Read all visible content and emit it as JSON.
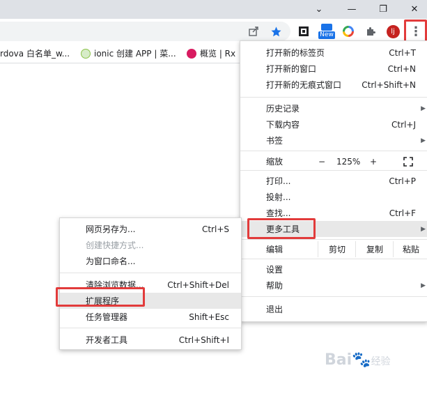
{
  "window_controls": {
    "minimize": "—",
    "restore": "❐",
    "close": "✕",
    "tab_search": "⌄"
  },
  "toolbar": {
    "share_icon": "share-icon",
    "star_icon": "star-icon",
    "new_badge": "New",
    "profile_initial": "lj",
    "menu_dots": "⋮"
  },
  "bookmarks": [
    {
      "label": "rdova 白名单_w..."
    },
    {
      "label": "ionic 创建 APP | 菜..."
    },
    {
      "label": "概览 | Rx"
    }
  ],
  "main_menu": {
    "items": {
      "new_tab": {
        "label": "打开新的标签页",
        "shortcut": "Ctrl+T"
      },
      "new_window": {
        "label": "打开新的窗口",
        "shortcut": "Ctrl+N"
      },
      "incognito": {
        "label": "打开新的无痕式窗口",
        "shortcut": "Ctrl+Shift+N"
      },
      "history": {
        "label": "历史记录"
      },
      "downloads": {
        "label": "下载内容",
        "shortcut": "Ctrl+J"
      },
      "bookmarks": {
        "label": "书签"
      },
      "zoom": {
        "label": "缩放",
        "minus": "−",
        "value": "125%",
        "plus": "+"
      },
      "print": {
        "label": "打印...",
        "shortcut": "Ctrl+P"
      },
      "cast": {
        "label": "投射..."
      },
      "find": {
        "label": "查找...",
        "shortcut": "Ctrl+F"
      },
      "more_tools": {
        "label": "更多工具"
      },
      "edit": {
        "label": "编辑",
        "cut": "剪切",
        "copy": "复制",
        "paste": "粘贴"
      },
      "settings": {
        "label": "设置"
      },
      "help": {
        "label": "帮助"
      },
      "exit": {
        "label": "退出"
      }
    }
  },
  "sub_menu": {
    "save_page": {
      "label": "网页另存为...",
      "shortcut": "Ctrl+S"
    },
    "create_shortcut": {
      "label": "创建快捷方式..."
    },
    "name_window": {
      "label": "为窗口命名..."
    },
    "clear_data": {
      "label": "清除浏览数据...",
      "shortcut": "Ctrl+Shift+Del"
    },
    "extensions": {
      "label": "扩展程序"
    },
    "task_manager": {
      "label": "任务管理器",
      "shortcut": "Shift+Esc"
    },
    "dev_tools": {
      "label": "开发者工具",
      "shortcut": "Ctrl+Shift+I"
    }
  },
  "watermark": {
    "text": "Bai",
    "suffix": "经验"
  },
  "colors": {
    "highlight": "#e23b3b",
    "star": "#1a73e8",
    "avatar": "#c5221f"
  }
}
